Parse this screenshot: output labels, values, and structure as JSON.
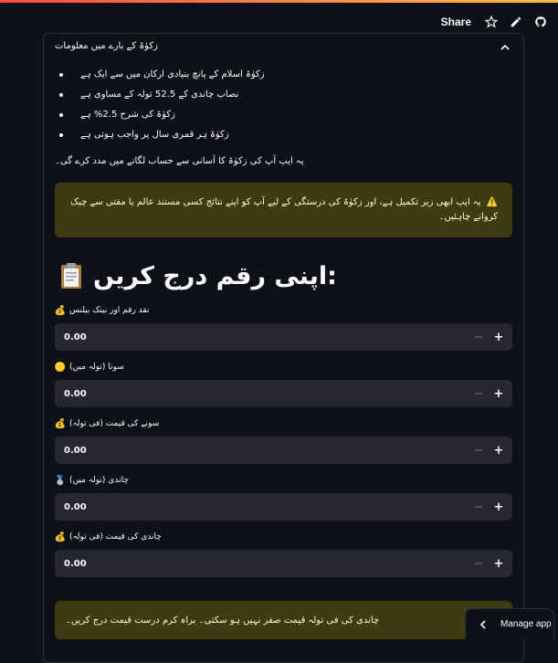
{
  "toolbar": {
    "share_label": "Share",
    "icons": [
      "star-icon",
      "pencil-icon",
      "github-icon"
    ]
  },
  "expander": {
    "title": "زکوٰۃ کے بارے میں معلومات",
    "facts": [
      "زکوٰۃ اسلام کے پانچ بنیادی ارکان میں سے ایک ہے",
      "نصاب چاندی کے 52.5 تولہ کے مساوی ہے",
      "زکوٰۃ کی شرح 2.5% ہے",
      "زکوٰۃ ہر قمری سال پر واجب ہوتی ہے"
    ],
    "intro": "یہ ایپ آپ کی زکوٰۃ کا آسانی سے حساب لگانے میں مدد کرے گی۔",
    "warning": {
      "icon": "⚠️",
      "text": "یہ ایپ ابھی زیر تکمیل ہے، اور زکوٰۃ کی درستگی کے لیے آپ کو اپنے نتائج کسی مستند عالم یا مفتی سے چیک کروانے چاہئیں۔"
    },
    "heading": ":اپنی رقم درج کریں",
    "fields": [
      {
        "emoji": "💰",
        "label": "نقد رقم اور بینک بیلنس",
        "value": "0.00"
      },
      {
        "emoji": "🟡",
        "label": "سونا (تولہ میں)",
        "value": "0.00"
      },
      {
        "emoji": "💰",
        "label": "سونے کی قیمت (فی تولہ)",
        "value": "0.00"
      },
      {
        "emoji": "🥈",
        "label": "چاندی (تولہ میں)",
        "value": "0.00"
      },
      {
        "emoji": "💰",
        "label": "چاندی کی قیمت (فی تولہ)",
        "value": "0.00"
      }
    ],
    "bottom_warning": "چاندی کی فی تولہ قیمت صفر نہیں ہو سکتی۔ براہ کرم درست قیمت درج کریں۔"
  },
  "manage_app": {
    "label": "Manage app"
  },
  "colors": {
    "background": "#0e1117",
    "input": "#262730",
    "warning_bg": "#3d3b11",
    "warning_text": "#ffffc2"
  }
}
